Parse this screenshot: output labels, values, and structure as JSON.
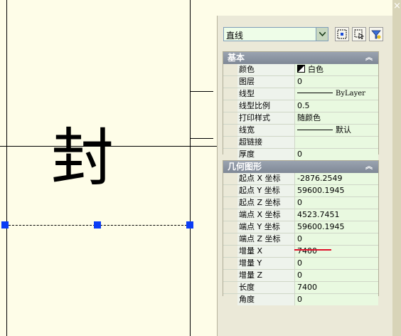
{
  "drawing": {
    "glyph": "封"
  },
  "properties": {
    "object_type": "直线",
    "tool_icons": [
      "quick-select-icon",
      "select-objects-icon",
      "toggle-pickadd-icon"
    ],
    "basic": {
      "title": "基本",
      "rows": [
        {
          "label": "颜色",
          "value": "白色"
        },
        {
          "label": "图层",
          "value": "0"
        },
        {
          "label": "线型",
          "value": "ByLayer"
        },
        {
          "label": "线型比例",
          "value": "0.5"
        },
        {
          "label": "打印样式",
          "value": "随颜色"
        },
        {
          "label": "线宽",
          "value": "默认"
        },
        {
          "label": "超链接",
          "value": ""
        },
        {
          "label": "厚度",
          "value": "0"
        }
      ]
    },
    "geometry": {
      "title": "几何图形",
      "rows": [
        {
          "label": "起点 X 坐标",
          "value": "-2876.2549"
        },
        {
          "label": "起点 Y 坐标",
          "value": "59600.1945"
        },
        {
          "label": "起点 Z 坐标",
          "value": "0"
        },
        {
          "label": "端点 X 坐标",
          "value": "4523.7451"
        },
        {
          "label": "端点 Y 坐标",
          "value": "59600.1945"
        },
        {
          "label": "端点 Z 坐标",
          "value": "0"
        },
        {
          "label": "增量 X",
          "value": "7400"
        },
        {
          "label": "增量 Y",
          "value": "0"
        },
        {
          "label": "增量 Z",
          "value": "0"
        },
        {
          "label": "长度",
          "value": "7400"
        },
        {
          "label": "角度",
          "value": "0"
        }
      ]
    }
  },
  "colors": {
    "canvas": "#fefde8",
    "grip": "#0a3cf5",
    "highlight_underline": "#e0102a"
  }
}
